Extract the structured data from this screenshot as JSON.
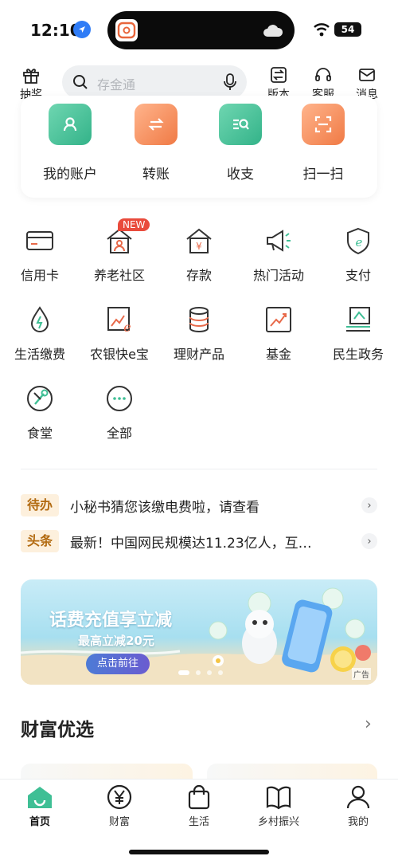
{
  "status_bar": {
    "time": "12:10",
    "battery": "54"
  },
  "top_nav": {
    "lottery": "抽奖",
    "search_placeholder": "存金通",
    "version": "版本",
    "service": "客服",
    "messages": "消息"
  },
  "quick_actions": [
    {
      "label": "我的账户",
      "icon": "account-icon",
      "color": "#3fbf95"
    },
    {
      "label": "转账",
      "icon": "transfer-icon",
      "color": "#f28c5a"
    },
    {
      "label": "收支",
      "icon": "income-expense-icon",
      "color": "#3fbf95"
    },
    {
      "label": "扫一扫",
      "icon": "scan-icon",
      "color": "#f28c5a"
    }
  ],
  "grid": {
    "new_badge": "NEW",
    "items": [
      {
        "label": "信用卡",
        "icon": "credit-card-icon"
      },
      {
        "label": "养老社区",
        "icon": "elderly-community-icon"
      },
      {
        "label": "存款",
        "icon": "deposit-icon"
      },
      {
        "label": "热门活动",
        "icon": "megaphone-icon"
      },
      {
        "label": "支付",
        "icon": "payment-shield-icon"
      },
      {
        "label": "生活缴费",
        "icon": "utility-drop-icon"
      },
      {
        "label": "农银快e宝",
        "icon": "e-treasure-icon"
      },
      {
        "label": "理财产品",
        "icon": "coin-stack-icon"
      },
      {
        "label": "基金",
        "icon": "fund-chart-icon"
      },
      {
        "label": "民生政务",
        "icon": "government-icon"
      },
      {
        "label": "食堂",
        "icon": "canteen-icon"
      },
      {
        "label": "全部",
        "icon": "more-icon"
      }
    ]
  },
  "notices": [
    {
      "tag": "待办",
      "text": "小秘书猜您该缴电费啦，请查看"
    },
    {
      "tag": "头条",
      "text": "最新！中国网民规模达11.23亿人，互…"
    }
  ],
  "banner": {
    "title": "话费充值享立减",
    "subtitle": "最高立减20元",
    "button": "点击前往",
    "ad_label": "广告"
  },
  "section": {
    "title": "财富优选",
    "arrow": "›"
  },
  "tabbar": [
    {
      "label": "首页",
      "icon": "home-icon",
      "active": true
    },
    {
      "label": "财富",
      "icon": "yuan-icon",
      "active": false
    },
    {
      "label": "生活",
      "icon": "shopping-bag-icon",
      "active": false
    },
    {
      "label": "乡村振兴",
      "icon": "rural-book-icon",
      "active": false
    },
    {
      "label": "我的",
      "icon": "profile-icon",
      "active": false
    }
  ],
  "colors": {
    "brand": "#3fbf95",
    "accent_orange": "#f28c5a",
    "badge_red": "#e94b3c"
  }
}
